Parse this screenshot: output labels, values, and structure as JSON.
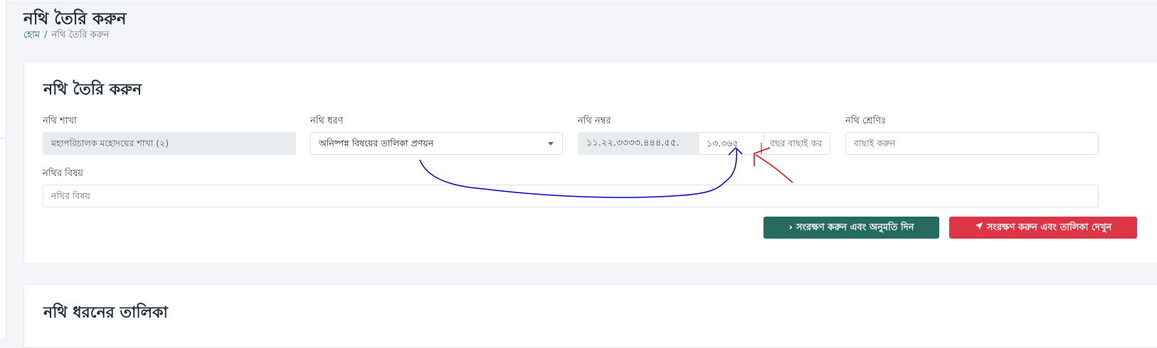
{
  "header": {
    "title": "নথি তৈরি করুন",
    "breadcrumb": {
      "home": "হোম",
      "separator": "/",
      "current": "নথি তৈরি করুন"
    }
  },
  "form": {
    "title": "নথি তৈরি করুন",
    "branch": {
      "label": "নথি শাখা",
      "value": "মহাপরিচালক মহোদয়ের শাখা (২)"
    },
    "type": {
      "label": "নথি ধরণ",
      "value": "অনিষ্পন্ন বিষয়ের তালিকা প্রণয়ন"
    },
    "number": {
      "label": "নথি নম্বর",
      "prefix": "১১.২২.৩৩৩৩.৪৪৪.৫৫.",
      "value": "১৩.৩৬৫",
      "year_placeholder": "বছর বাছাই কর"
    },
    "category": {
      "label": "নথি শ্রেণিঃ",
      "placeholder": "বাছাই করুন"
    },
    "subject": {
      "label": "নথির বিষয়",
      "placeholder": "নথির বিষয়"
    },
    "buttons": {
      "save_approve": "সংরক্ষণ করুন এবং অনুমতি দিন",
      "save_list": "সংরক্ষণ করুন এবং তালিকা দেখুন"
    },
    "colors": {
      "primary": "#256b5f",
      "danger": "#dc3545",
      "annotation_blue": "#0000cc",
      "annotation_red": "#e00000"
    }
  },
  "list_section": {
    "title": "নথি ধরনের তালিকা"
  }
}
